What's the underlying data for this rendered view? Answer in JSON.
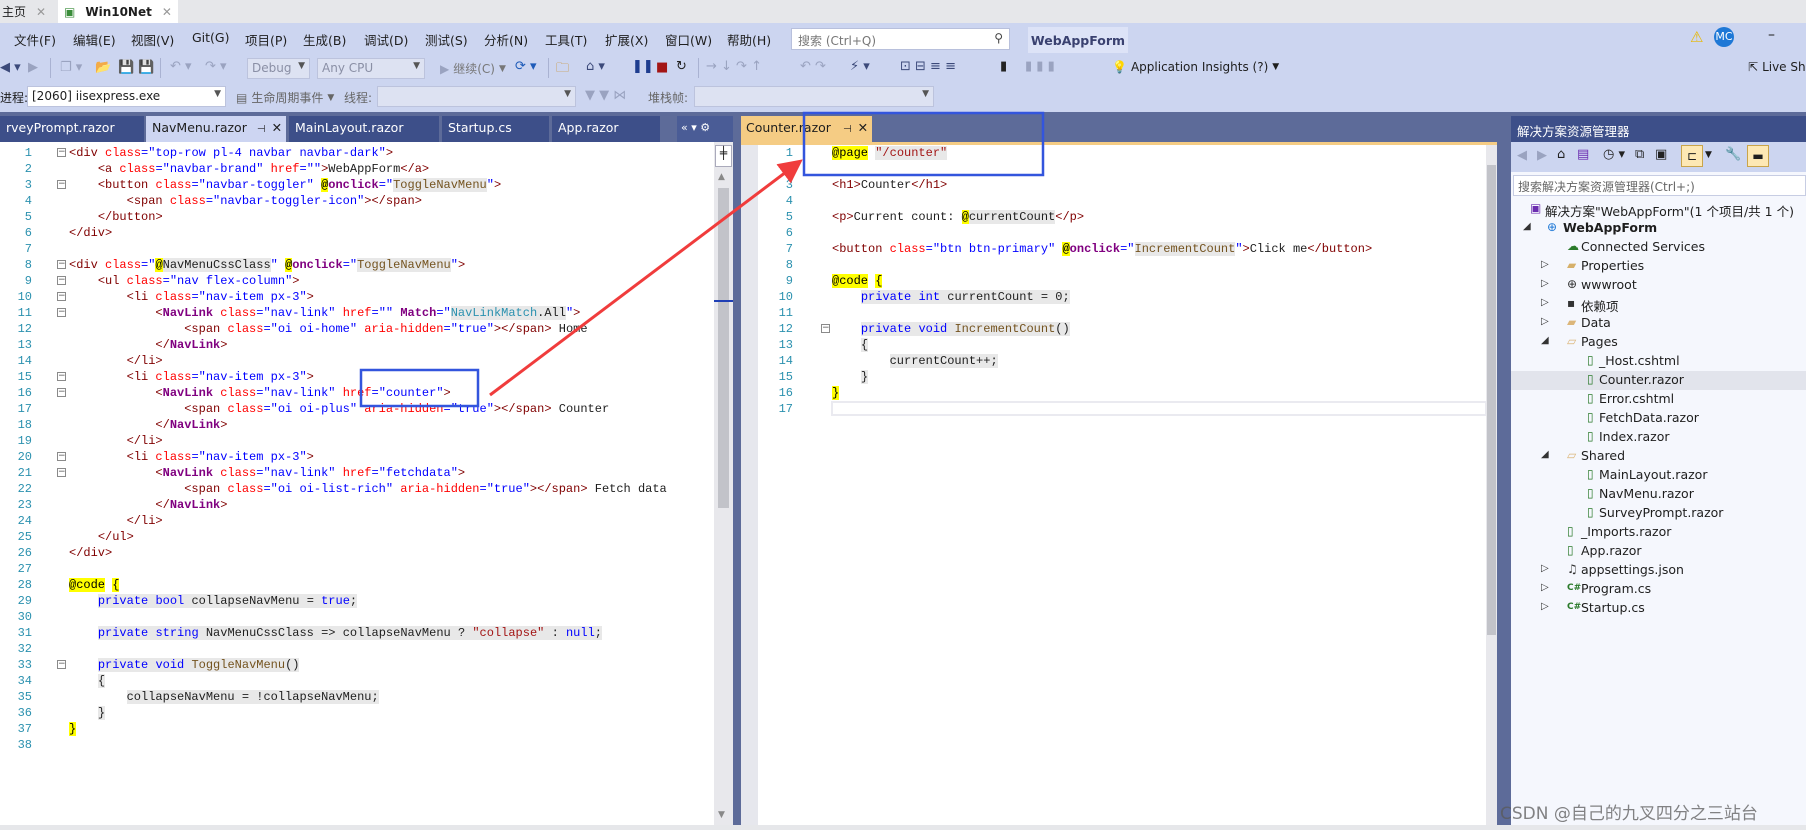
{
  "top_tabs": [
    {
      "label": "主页"
    },
    {
      "label": "Win10Net"
    }
  ],
  "menu": [
    "文件(F)",
    "编辑(E)",
    "视图(V)",
    "Git(G)",
    "项目(P)",
    "生成(B)",
    "调试(D)",
    "测试(S)",
    "分析(N)",
    "工具(T)",
    "扩展(X)",
    "窗口(W)",
    "帮助(H)"
  ],
  "search": {
    "placeholder": "搜索 (Ctrl+Q)"
  },
  "solution_title": "WebAppForm",
  "account": {
    "initials": "MC",
    "warning_icon": "warning-icon"
  },
  "toolbar": {
    "config": "Debug",
    "platform": "Any CPU",
    "continue": "继续(C)",
    "app_insights": "Application Insights (?)",
    "live_share": "Live Sh"
  },
  "debugbar": {
    "process_label": "进程:",
    "process": "[2060] iisexpress.exe",
    "lifecycle": "生命周期事件",
    "thread_label": "线程:",
    "stack_label": "堆栈帧:"
  },
  "doc_tabs": [
    {
      "label": "rveyPrompt.razor"
    },
    {
      "label": "NavMenu.razor",
      "active": true
    },
    {
      "label": "MainLayout.razor"
    },
    {
      "label": "Startup.cs"
    },
    {
      "label": "App.razor"
    }
  ],
  "right_tab": {
    "label": "Counter.razor"
  },
  "left_file": {
    "collapsible_lines": [
      1,
      3,
      8,
      9,
      10,
      11,
      15,
      16,
      20,
      21,
      33
    ],
    "lines": [
      "<div class=\"top-row pl-4 navbar navbar-dark\">",
      "    <a class=\"navbar-brand\" href=\"\">WebAppForm</a>",
      "    <button class=\"navbar-toggler\" @onclick=\"ToggleNavMenu\">",
      "        <span class=\"navbar-toggler-icon\"></span>",
      "    </button>",
      "</div>",
      "",
      "<div class=\"@NavMenuCssClass\" @onclick=\"ToggleNavMenu\">",
      "    <ul class=\"nav flex-column\">",
      "        <li class=\"nav-item px-3\">",
      "            <NavLink class=\"nav-link\" href=\"\" Match=\"NavLinkMatch.All\">",
      "                <span class=\"oi oi-home\" aria-hidden=\"true\"></span> Home",
      "            </NavLink>",
      "        </li>",
      "        <li class=\"nav-item px-3\">",
      "            <NavLink class=\"nav-link\" href=\"counter\">",
      "                <span class=\"oi oi-plus\" aria-hidden=\"true\"></span> Counter",
      "            </NavLink>",
      "        </li>",
      "        <li class=\"nav-item px-3\">",
      "            <NavLink class=\"nav-link\" href=\"fetchdata\">",
      "                <span class=\"oi oi-list-rich\" aria-hidden=\"true\"></span> Fetch data",
      "            </NavLink>",
      "        </li>",
      "    </ul>",
      "</div>",
      "",
      "@code {",
      "    private bool collapseNavMenu = true;",
      "",
      "    private string NavMenuCssClass => collapseNavMenu ? \"collapse\" : null;",
      "",
      "    private void ToggleNavMenu()",
      "    {",
      "        collapseNavMenu = !collapseNavMenu;",
      "    }",
      "}",
      ""
    ]
  },
  "right_file": {
    "collapsible_lines": [
      12
    ],
    "lines": [
      "@page \"/counter\"",
      "",
      "<h1>Counter</h1>",
      "",
      "<p>Current count: @currentCount</p>",
      "",
      "<button class=\"btn btn-primary\" @onclick=\"IncrementCount\">Click me</button>",
      "",
      "@code {",
      "    private int currentCount = 0;",
      "",
      "    private void IncrementCount()",
      "    {",
      "        currentCount++;",
      "    }",
      "}",
      ""
    ]
  },
  "solution_explorer": {
    "title": "解决方案资源管理器",
    "search_placeholder": "搜索解决方案资源管理器(Ctrl+;)",
    "items": [
      {
        "label": "解决方案\"WebAppForm\"(1 个项目/共 1 个)",
        "level": 0,
        "icon": "solution-icon"
      },
      {
        "label": "WebAppForm",
        "level": 0,
        "expanded": true,
        "bold": true,
        "icon": "web-project-icon"
      },
      {
        "label": "Connected Services",
        "level": 1,
        "icon": "connected-services-icon"
      },
      {
        "label": "Properties",
        "level": 1,
        "expanded": false,
        "icon": "properties-folder-icon"
      },
      {
        "label": "wwwroot",
        "level": 1,
        "expanded": false,
        "icon": "globe-icon"
      },
      {
        "label": "依赖项",
        "level": 1,
        "expanded": false,
        "icon": "dependencies-icon"
      },
      {
        "label": "Data",
        "level": 1,
        "expanded": false,
        "icon": "folder-icon"
      },
      {
        "label": "Pages",
        "level": 1,
        "expanded": true,
        "icon": "folder-open-icon"
      },
      {
        "label": "_Host.cshtml",
        "level": 2,
        "icon": "razor-file-icon"
      },
      {
        "label": "Counter.razor",
        "level": 2,
        "icon": "razor-file-icon",
        "selected": true
      },
      {
        "label": "Error.cshtml",
        "level": 2,
        "icon": "razor-file-icon"
      },
      {
        "label": "FetchData.razor",
        "level": 2,
        "icon": "razor-file-icon"
      },
      {
        "label": "Index.razor",
        "level": 2,
        "icon": "razor-file-icon"
      },
      {
        "label": "Shared",
        "level": 1,
        "expanded": true,
        "icon": "folder-open-icon"
      },
      {
        "label": "MainLayout.razor",
        "level": 2,
        "icon": "razor-file-icon"
      },
      {
        "label": "NavMenu.razor",
        "level": 2,
        "icon": "razor-file-icon"
      },
      {
        "label": "SurveyPrompt.razor",
        "level": 2,
        "icon": "razor-file-icon"
      },
      {
        "label": "_Imports.razor",
        "level": 1,
        "icon": "razor-file-icon"
      },
      {
        "label": "App.razor",
        "level": 1,
        "icon": "razor-file-icon"
      },
      {
        "label": "appsettings.json",
        "level": 1,
        "expanded": false,
        "icon": "json-file-icon"
      },
      {
        "label": "Program.cs",
        "level": 1,
        "expanded": false,
        "icon": "csharp-file-icon"
      },
      {
        "label": "Startup.cs",
        "level": 1,
        "expanded": false,
        "icon": "csharp-file-icon"
      }
    ]
  },
  "watermark": "CSDN @自己的九叉四分之三站台",
  "colors": {
    "accent_tab": "#f5cc84",
    "annotation_box": "#3355dd",
    "annotation_arrow": "#f03c3c",
    "chrome": "#ccd5f0",
    "dark_chrome": "#3d4f89"
  }
}
